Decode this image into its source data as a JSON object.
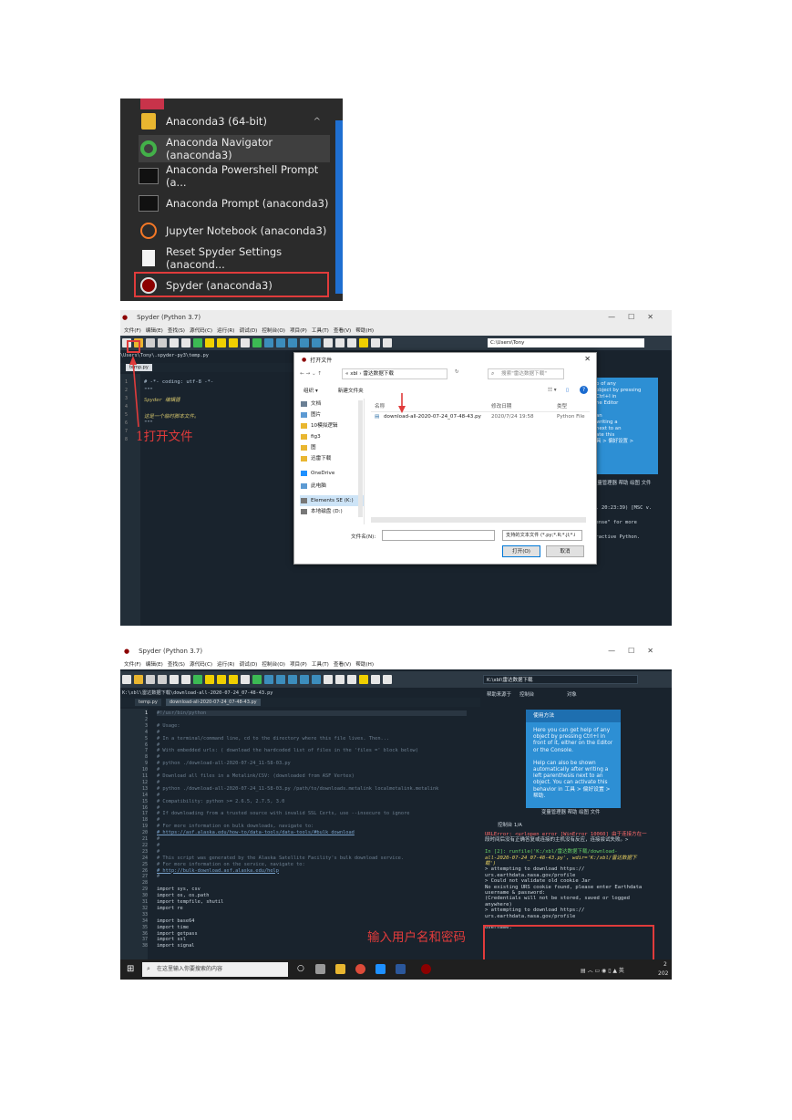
{
  "shot1": {
    "group_label": "Anaconda3 (64-bit)",
    "items": [
      {
        "label": "Anaconda Navigator (anaconda3)",
        "icon": "navigator-icon"
      },
      {
        "label": "Anaconda Powershell Prompt (a...",
        "icon": "terminal-icon"
      },
      {
        "label": "Anaconda Prompt (anaconda3)",
        "icon": "terminal-icon"
      },
      {
        "label": "Jupyter Notebook (anaconda3)",
        "icon": "jupyter-icon"
      },
      {
        "label": "Reset Spyder Settings (anacond...",
        "icon": "document-icon"
      },
      {
        "label": "Spyder (anaconda3)",
        "icon": "spyder-icon"
      }
    ]
  },
  "shot2": {
    "window_title": "Spyder (Python 3.7)",
    "menu": [
      "文件(F)",
      "编辑(E)",
      "查找(S)",
      "源代码(C)",
      "运行(R)",
      "调试(D)",
      "控制台(O)",
      "项目(P)",
      "工具(T)",
      "查看(V)",
      "帮助(H)"
    ],
    "path_box": "C:\\Users\\Tony",
    "file_path": "\\Users\\Tony\\.spyder-py3\\temp.py",
    "tab": "temp.py",
    "code_lines": [
      "# -*- coding: utf-8 -*-",
      "\"\"\"",
      "Spyder 编辑器",
      "",
      "这是一个临时脚本文件。",
      "\"\"\""
    ],
    "line_numbers": [
      "1",
      "2",
      "3",
      "4",
      "5",
      "6",
      "7",
      "8"
    ],
    "annotation": "1打开文件",
    "help_text": [
      "p of any",
      "object by pressing",
      "Ctrl+I in",
      "he Editor",
      "",
      "an",
      "writing a",
      "next to an",
      "ate this",
      "具 > 偏好设置 >"
    ],
    "pane_tabs": "变量管理器 帮助 绘图 文件",
    "console_lines": [
      "20, 20:23:39) [MSC v.",
      "icense\" for more",
      "teractive Python."
    ],
    "dialog": {
      "title": "打开文件",
      "breadcrumb": "« xbl › 雷达数据下载",
      "search_placeholder": "搜索\"雷达数据下载\"",
      "organize": "组织 ▾",
      "new_folder": "新建文件夹",
      "tree": [
        "文档",
        "图片",
        "10模拟逻辑",
        "fig3",
        "图",
        "迅雷下载",
        "OneDrive",
        "此电脑",
        "Elements SE (K:)",
        "本地磁盘 (D:)"
      ],
      "col_name": "名称",
      "col_date": "修改日期",
      "col_type": "类型",
      "file_name": "download-all-2020-07-24_07-48-43.py",
      "file_date": "2020/7/24 19:58",
      "file_type": "Python File",
      "filename_label": "文件名(N):",
      "filter": "支持的文本文件 (*.py;*.R;*.jl;*.i",
      "open_button": "打开(O)",
      "cancel_button": "取消"
    }
  },
  "shot3": {
    "window_title": "Spyder (Python 3.7)",
    "menu": [
      "文件(F)",
      "编辑(E)",
      "查找(S)",
      "源代码(C)",
      "运行(R)",
      "调试(D)",
      "控制台(O)",
      "项目(P)",
      "工具(T)",
      "查看(V)",
      "帮助(H)"
    ],
    "path_box": "K:\\xbl\\雷达数据下载",
    "file_path": "K:\\xbl\\雷达数据下载\\download-all-2020-07-24_07-48-43.py",
    "tabs": [
      "temp.py",
      "download-all-2020-07-24_07-48-43.py"
    ],
    "help_pane_label": "帮助来源于",
    "help_pane_source": "控制台",
    "help_pane_object": "对象",
    "help_title": "使用方法",
    "help_body": [
      "Here you can get help of any",
      "object by pressing Ctrl+I in",
      "front of it, either on the Editor",
      "or the Console.",
      "",
      "Help can also be shown",
      "automatically after writing a",
      "left parenthesis next to an",
      "object. You can activate this",
      "behavior in 工具 > 偏好设置 >",
      "帮助."
    ],
    "pane_tabs": "变量管理器 帮助 绘图 文件",
    "console_tab": "控制台 1/A",
    "code": [
      {
        "n": "1",
        "t": "#!/usr/bin/python",
        "k": "c"
      },
      {
        "n": "2",
        "t": "",
        "k": "c"
      },
      {
        "n": "3",
        "t": "# Usage:",
        "k": "c"
      },
      {
        "n": "4",
        "t": "#",
        "k": "c"
      },
      {
        "n": "5",
        "t": "#    In a terminal/command line, cd to the directory where this file lives. Then...",
        "k": "c"
      },
      {
        "n": "6",
        "t": "#",
        "k": "c"
      },
      {
        "n": "7",
        "t": "#    With embedded urls: ( download the hardcoded list of files in the 'files =' block below)",
        "k": "c"
      },
      {
        "n": "8",
        "t": "#",
        "k": "c"
      },
      {
        "n": "9",
        "t": "#       python ./download-all-2020-07-24_11-58-03.py",
        "k": "c"
      },
      {
        "n": "10",
        "t": "#",
        "k": "c"
      },
      {
        "n": "11",
        "t": "#    Download all files in a Metalink/CSV: (downloaded from ASF Vertex)",
        "k": "c"
      },
      {
        "n": "12",
        "t": "#",
        "k": "c"
      },
      {
        "n": "13",
        "t": "#       python ./download-all-2020-07-24_11-58-03.py /path/to/downloads.metalink localmetalink.metalink",
        "k": "c"
      },
      {
        "n": "14",
        "t": "#",
        "k": "c"
      },
      {
        "n": "15",
        "t": "#    Compatibility: python >= 2.6.5, 2.7.5, 3.0",
        "k": "c"
      },
      {
        "n": "16",
        "t": "#",
        "k": "c"
      },
      {
        "n": "17",
        "t": "#    If downloading from a trusted source with invalid SSL Certs, use --insecure to ignore",
        "k": "c"
      },
      {
        "n": "18",
        "t": "#",
        "k": "c"
      },
      {
        "n": "19",
        "t": "#    For more information on bulk downloads, navigate to:",
        "k": "c"
      },
      {
        "n": "20",
        "t": "#        https://asf.alaska.edu/how-to/data-tools/data-tools/#bulk_download",
        "k": "l"
      },
      {
        "n": "21",
        "t": "#",
        "k": "c"
      },
      {
        "n": "22",
        "t": "#",
        "k": "c"
      },
      {
        "n": "23",
        "t": "#",
        "k": "c"
      },
      {
        "n": "24",
        "t": "#    This script was generated by the Alaska Satellite Facility's bulk download service.",
        "k": "c"
      },
      {
        "n": "25",
        "t": "#    For more information on the service, navigate to:",
        "k": "c"
      },
      {
        "n": "26",
        "t": "#        http://bulk-download.asf.alaska.edu/help",
        "k": "l"
      },
      {
        "n": "27",
        "t": "#",
        "k": "c"
      },
      {
        "n": "28",
        "t": "",
        "k": "c"
      },
      {
        "n": "29",
        "t": "import sys, csv",
        "k": "k"
      },
      {
        "n": "30",
        "t": "import os, os.path",
        "k": "k"
      },
      {
        "n": "31",
        "t": "import tempfile, shutil",
        "k": "k"
      },
      {
        "n": "32",
        "t": "import re",
        "k": "k"
      },
      {
        "n": "33",
        "t": "",
        "k": "c"
      },
      {
        "n": "34",
        "t": "import base64",
        "k": "k"
      },
      {
        "n": "35",
        "t": "import time",
        "k": "k"
      },
      {
        "n": "36",
        "t": "import getpass",
        "k": "k"
      },
      {
        "n": "37",
        "t": "import ssl",
        "k": "k"
      },
      {
        "n": "38",
        "t": "import signal",
        "k": "k"
      }
    ],
    "console": [
      {
        "t": "URLError: <urlopen error [WinError 10060] 由于连接方在一",
        "k": "r"
      },
      {
        "t": "段时间后没有正确答复或连接的主机没有反应，连接尝试失败。>",
        "k": "w"
      },
      {
        "t": "",
        "k": "w"
      },
      {
        "t": "In [2]: runfile('K:/xbl/雷达数据下载/download-",
        "k": "gr"
      },
      {
        "t": "all-2020-07-24_07-48-43.py', wdir='K:/xbl/雷达数据下",
        "k": "y"
      },
      {
        "t": "载')",
        "k": "y"
      },
      {
        "t": " > attempting to download https://",
        "k": "w"
      },
      {
        "t": "urs.earthdata.nasa.gov/profile",
        "k": "w"
      },
      {
        "t": " > Could not validate old cookie Jar",
        "k": "w"
      },
      {
        "t": "No existing URS cookie found, please enter Earthdata",
        "k": "w"
      },
      {
        "t": "username & password:",
        "k": "w"
      },
      {
        "t": "(Credentials will not be stored, saved or logged",
        "k": "w"
      },
      {
        "t": "anywhere)",
        "k": "w"
      },
      {
        "t": " > attempting to download https://",
        "k": "w"
      },
      {
        "t": "urs.earthdata.nasa.gov/profile",
        "k": "w"
      },
      {
        "t": "",
        "k": "w"
      },
      {
        "t": "Username:",
        "k": "w"
      }
    ],
    "annotation": "输入用户名和密码",
    "taskbar_search": "在这里输入你要搜索的内容",
    "taskbar_time": "2",
    "taskbar_year": "202"
  },
  "colors": {
    "accent_red": "#e03b3b",
    "spyder_dark": "#19232d",
    "help_blue": "#2d8fd4"
  }
}
